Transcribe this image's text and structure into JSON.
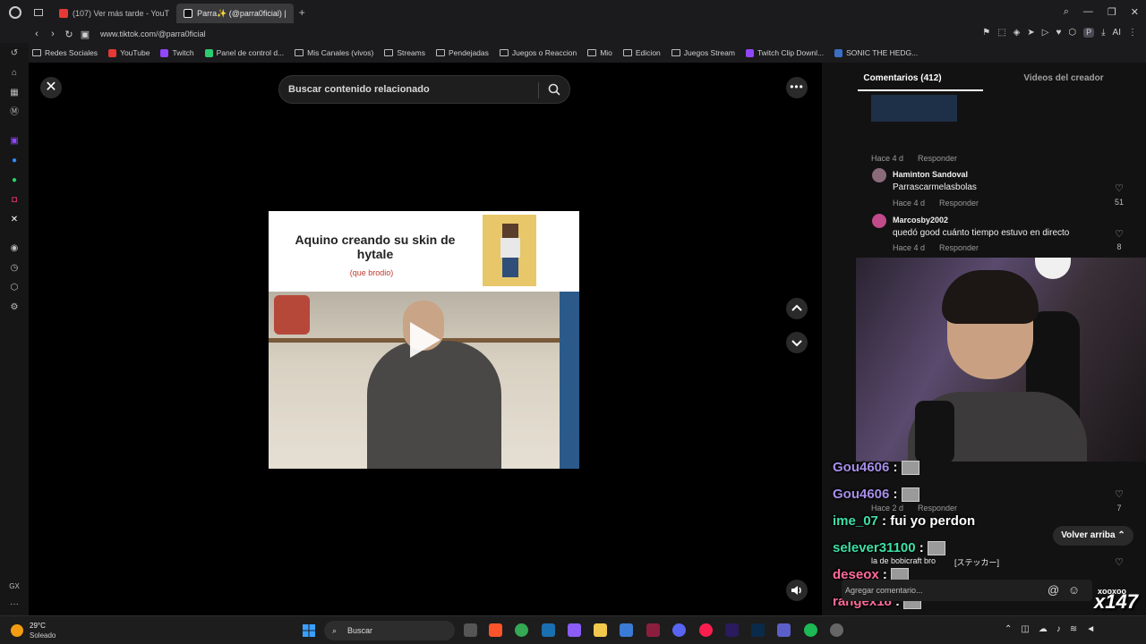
{
  "tabs": [
    {
      "label": "(107) Ver más tarde - YouT",
      "active": false,
      "color": "#e53935"
    },
    {
      "label": "Parra✨ (@parra0ficial) |",
      "active": true,
      "color": "#ffffff"
    }
  ],
  "address": {
    "url": "www.tiktok.com/@parra0ficial"
  },
  "extensions": {
    "profile": "P",
    "ai": "AI"
  },
  "bookmarks": [
    {
      "label": "Redes Sociales",
      "type": "folder"
    },
    {
      "label": "YouTube",
      "type": "site",
      "color": "#e53935"
    },
    {
      "label": "Twitch",
      "type": "site",
      "color": "#9146ff"
    },
    {
      "label": "Panel de control d...",
      "type": "site",
      "color": "#2ecc71"
    },
    {
      "label": "Mis Canales (vivos)",
      "type": "folder"
    },
    {
      "label": "Streams",
      "type": "folder"
    },
    {
      "label": "Pendejadas",
      "type": "folder"
    },
    {
      "label": "Juegos o Reaccion",
      "type": "folder"
    },
    {
      "label": "Mio",
      "type": "folder"
    },
    {
      "label": "Edicion",
      "type": "folder"
    },
    {
      "label": "Juegos Stream",
      "type": "folder"
    },
    {
      "label": "Twitch Clip Downl...",
      "type": "site",
      "color": "#9146ff"
    },
    {
      "label": "SONIC THE HEDG...",
      "type": "site",
      "color": "#3a6fc4"
    }
  ],
  "sidebar_bottom": {
    "gx": "GX",
    "more": "···"
  },
  "viewer": {
    "search_placeholder": "Buscar contenido relacionado",
    "video_caption": "Aquino creando su skin de hytale",
    "video_subcaption": "(que brodio)"
  },
  "comments_panel": {
    "tab_comments": "Comentarios (412)",
    "tab_creator": "Videos del creador",
    "items": [
      {
        "meta": "Hace 4 d",
        "reply": "Responder"
      },
      {
        "name": "Haminton Sandoval",
        "text": "Parrascarmelasbolas",
        "meta": "Hace 4 d",
        "reply": "Responder",
        "likes": "51"
      },
      {
        "name": "Marcosby2002",
        "text": "quedó good cuánto tiempo estuvo en directo",
        "meta": "Hace 4 d",
        "reply": "Responder",
        "likes": "8"
      },
      {
        "meta": "Hace 2 d",
        "reply": "Responder",
        "likes": "7"
      },
      {
        "text": "la de bobicraft bro",
        "sticker": "[ステッカー]"
      }
    ],
    "back_to_top": "Volver arriba",
    "add_comment": "Agregar comentario..."
  },
  "stream_chat": [
    {
      "user": "Gou4606",
      "sep": " :",
      "msg": "",
      "color": "#a68ee8"
    },
    {
      "user": "Gou4606",
      "sep": " :",
      "msg": "",
      "color": "#a68ee8"
    },
    {
      "user": "ime_07",
      "sep": " :",
      "msg": " fui yo perdon",
      "color": "#3ee0a6"
    },
    {
      "user": "selever31100",
      "sep": " :",
      "msg": "",
      "color": "#3ee0a6"
    },
    {
      "user": "deseox",
      "sep": " :",
      "msg": "",
      "color": "#ff6b9a"
    },
    {
      "user": "rangex18",
      "sep": " :",
      "msg": "",
      "color": "#ff6b9a"
    }
  ],
  "overlay": {
    "xoxo": "xooxoo",
    "x147": "x147"
  },
  "taskbar": {
    "weather_temp": "29°C",
    "weather_desc": "Soleado",
    "search_label": "Buscar"
  }
}
